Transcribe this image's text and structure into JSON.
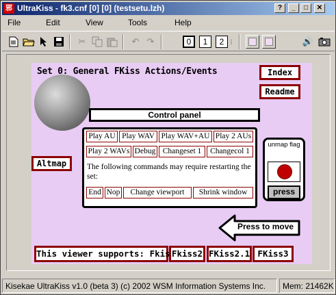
{
  "window": {
    "title": "UltraKiss - fk3.cnf [0] [0]  (testsetu.lzh)",
    "app_icon_glyph": "邪"
  },
  "menu": [
    {
      "label": "File"
    },
    {
      "label": "Edit"
    },
    {
      "label": "View"
    },
    {
      "label": "Tools"
    },
    {
      "label": "Help"
    }
  ],
  "toolbar": {
    "pages": [
      "0",
      "1",
      "2"
    ],
    "selected_page": "0"
  },
  "kiss": {
    "set_title": "Set 0: General FKiss Actions/Events",
    "index_label": "Index",
    "readme_label": "Readme",
    "altmap_label": "Altmap",
    "control_panel_title": "Control panel",
    "commands_row1": [
      "Play AU",
      "Play WAV",
      "Play WAV+AU",
      "Play 2 AUs"
    ],
    "commands_row2": [
      "Play 2 WAVs",
      "Debug",
      "Changeset 1",
      "Changecol 1"
    ],
    "restart_note": "The following commands may require restarting the set:",
    "commands_row3": [
      "End",
      "Nop",
      "Change viewport",
      "Shrink window"
    ],
    "unmap_label": "unmap flag",
    "press_label": "press",
    "press_to_move": "Press to move",
    "supports": [
      "This viewer supports: Fkiss",
      "Fkiss2",
      "FKiss2.1",
      "FKiss3"
    ],
    "colors": {
      "background": "#e8ccf4",
      "border_accent": "#8b0000",
      "flag_red": "#c00000"
    }
  },
  "status": {
    "text": "Kisekae UltraKiss v1.0 (beta 3) (c) 2002 WSM Information Systems Inc.",
    "memory": "Mem: 21462K"
  }
}
